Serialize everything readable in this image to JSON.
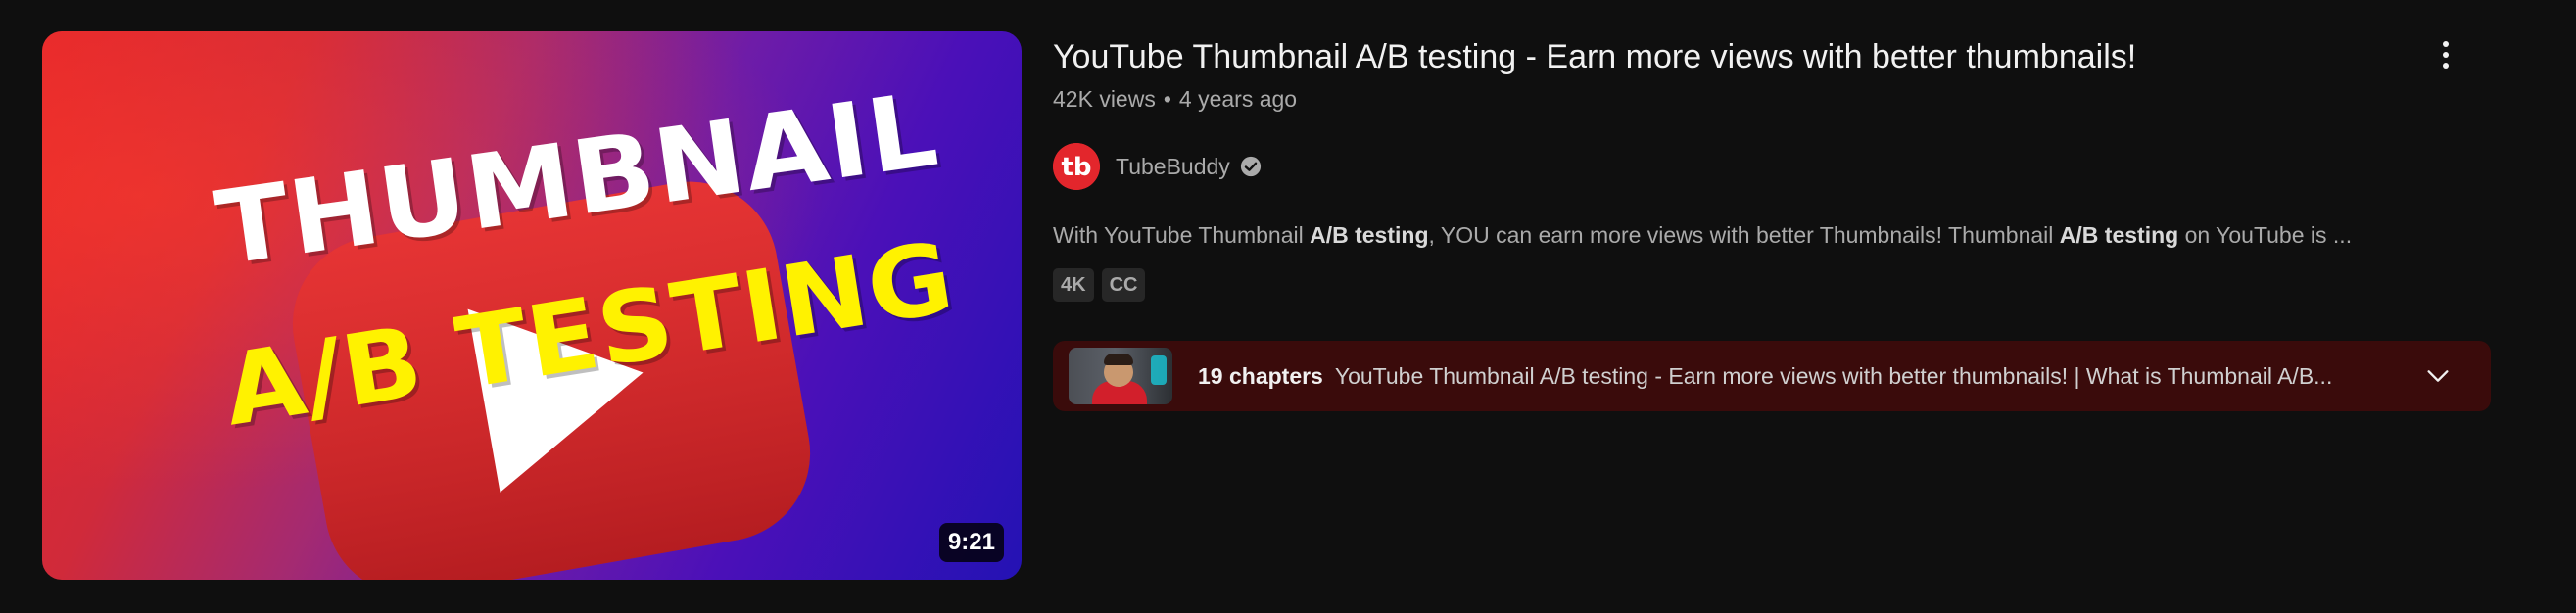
{
  "video": {
    "title": "YouTube Thumbnail A/B testing - Earn more views with better thumbnails!",
    "views": "42K views",
    "separator": "•",
    "age": "4 years ago",
    "duration": "9:21",
    "thumbnail": {
      "line1": "THUMBNAIL",
      "line2": "A/B TESTING",
      "play_icon": "play-icon"
    }
  },
  "channel": {
    "name": "TubeBuddy",
    "avatar_text": "tb",
    "verified_icon": "verified-check-icon",
    "accent": "#e3262c"
  },
  "description": {
    "part1": "With YouTube Thumbnail ",
    "bold1": "A/B testing",
    "part2": ", YOU can earn more views with better Thumbnails! Thumbnail ",
    "bold2": "A/B testing",
    "part3": " on YouTube is ..."
  },
  "badges": [
    "4K",
    "CC"
  ],
  "chapters": {
    "count_label": "19 chapters",
    "text": "YouTube Thumbnail A/B testing - Earn more views with better thumbnails! | What is Thumbnail A/B...",
    "background": "#3a0b0b",
    "chevron_icon": "chevron-down-icon"
  },
  "actions": {
    "more_icon": "more-vert-icon"
  }
}
